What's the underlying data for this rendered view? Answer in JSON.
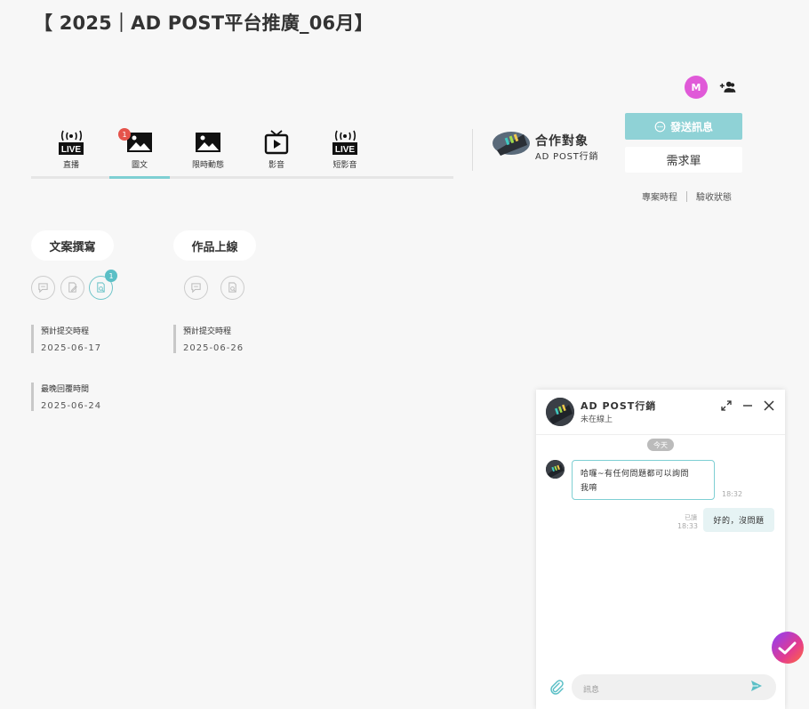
{
  "page_title": "【 2025｜AD POST平台推廣_06月】",
  "user_avatar_letter": "M",
  "tabs": [
    {
      "label": "直播",
      "icon": "live-icon",
      "active": false,
      "badge": ""
    },
    {
      "label": "圖文",
      "icon": "image-icon",
      "active": true,
      "badge": "1"
    },
    {
      "label": "限時動態",
      "icon": "image-icon",
      "active": false,
      "badge": ""
    },
    {
      "label": "影音",
      "icon": "tv-icon",
      "active": false,
      "badge": ""
    },
    {
      "label": "短影音",
      "icon": "live-icon",
      "active": false,
      "badge": ""
    }
  ],
  "live_text": "LIVE",
  "partner": {
    "title": "合作對象",
    "name": "AD POST行銷"
  },
  "buttons": {
    "send_message": "發送訊息",
    "requirements": "需求單"
  },
  "links": {
    "project_schedule": "專案時程",
    "acceptance_status": "驗收狀態"
  },
  "stages": [
    {
      "title": "文案撰寫",
      "step_badge": "1",
      "dates": [
        {
          "label": "預計提交時程",
          "value": "2025-06-17"
        },
        {
          "label": "最晚回覆時間",
          "value": "2025-06-24"
        }
      ]
    },
    {
      "title": "作品上線",
      "dates": [
        {
          "label": "預計提交時程",
          "value": "2025-06-26"
        }
      ]
    }
  ],
  "chat": {
    "name": "AD POST行銷",
    "status": "未在線上",
    "day_label": "今天",
    "messages": [
      {
        "from": "partner",
        "text_line1": "哈囉~有任何問題都可以詢問",
        "text_line2": "我唷",
        "time": "18:32"
      },
      {
        "from": "me",
        "text": "好的，沒問題",
        "read": "已讀",
        "time": "18:33"
      }
    ],
    "input_placeholder": "訊息"
  },
  "colors": {
    "accent": "#7ecfd3",
    "badge_red": "#e5534b",
    "avatar": "#e05ad8"
  }
}
